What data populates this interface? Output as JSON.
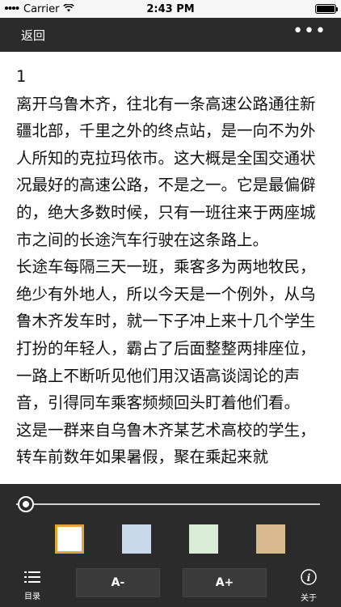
{
  "status_bar": {
    "carrier": "Carrier",
    "time": "2:43 PM"
  },
  "nav": {
    "back_label": "返回",
    "more_label": "•••"
  },
  "content": {
    "chapter": "1",
    "paragraphs": [
      "离开乌鲁木齐，往北有一条高速公路通往新疆北部，千里之外的终点站，是一向不为外人所知的克拉玛依市。这大概是全国交通状况最好的高速公路，不是之一。它是最偏僻的，绝大多数时候，只有一班往来于两座城市之间的长途汽车行驶在这条路上。",
      "长途车每隔三天一班，乘客多为两地牧民，绝少有外地人，所以今天是一个例外，从乌鲁木齐发车时，就一下子冲上来十几个学生打扮的年轻人，霸占了后面整整两排座位，一路上不断听见他们用汉语高谈阔论的声音，引得同车乘客频频回头盯着他们看。",
      "这是一群来自乌鲁木齐某艺术高校的学生，转车前数年如果暑假，聚在乘起来就"
    ]
  },
  "panel": {
    "progress": 0.0,
    "swatches": [
      {
        "name": "white",
        "color": "#ffffff",
        "selected": true
      },
      {
        "name": "blue",
        "color": "#c7d9ea",
        "selected": false
      },
      {
        "name": "green",
        "color": "#d9ecd5",
        "selected": false
      },
      {
        "name": "tan",
        "color": "#d8b98f",
        "selected": false
      }
    ],
    "accent_color": "#e6a23c",
    "toolbar": {
      "toc_label": "目录",
      "font_decrease_label": "A-",
      "font_increase_label": "A+",
      "about_label": "关于"
    }
  }
}
